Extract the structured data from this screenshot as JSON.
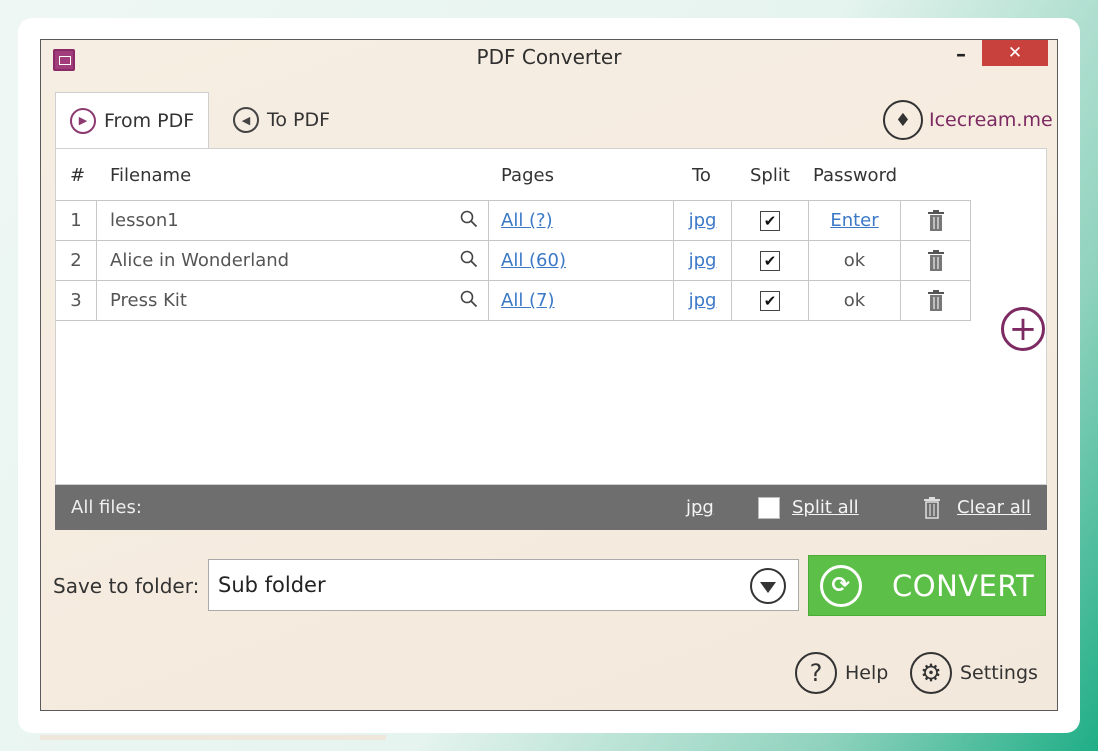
{
  "window": {
    "title": "PDF Converter",
    "minimize": "–",
    "close": "✕"
  },
  "tabs": [
    {
      "label": "From PDF",
      "active": true
    },
    {
      "label": "To PDF",
      "active": false
    }
  ],
  "brand": {
    "label": "Icecream.me"
  },
  "table": {
    "headers": {
      "num": "#",
      "filename": "Filename",
      "pages": "Pages",
      "to": "To",
      "split": "Split",
      "password": "Password"
    },
    "rows": [
      {
        "num": "1",
        "filename": "lesson1",
        "pages": "All (?)",
        "to": "jpg",
        "split": true,
        "password": "Enter",
        "password_link": true
      },
      {
        "num": "2",
        "filename": "Alice in Wonderland",
        "pages": "All (60)",
        "to": "jpg",
        "split": true,
        "password": "ok",
        "password_link": false
      },
      {
        "num": "3",
        "filename": "Press Kit",
        "pages": "All (7)",
        "to": "jpg",
        "split": true,
        "password": "ok",
        "password_link": false
      }
    ]
  },
  "all_files": {
    "label": "All files:",
    "format": "jpg",
    "split_all": "Split all",
    "clear_all": "Clear all"
  },
  "save": {
    "label": "Save to folder:",
    "value": "Sub folder"
  },
  "convert": {
    "label": "CONVERT"
  },
  "footer": {
    "help": "Help",
    "settings": "Settings"
  },
  "colors": {
    "accent": "#7d2a62",
    "convert": "#5cbf47",
    "link": "#3b79c7",
    "close": "#c9413c",
    "bar": "#6e6e6e"
  }
}
